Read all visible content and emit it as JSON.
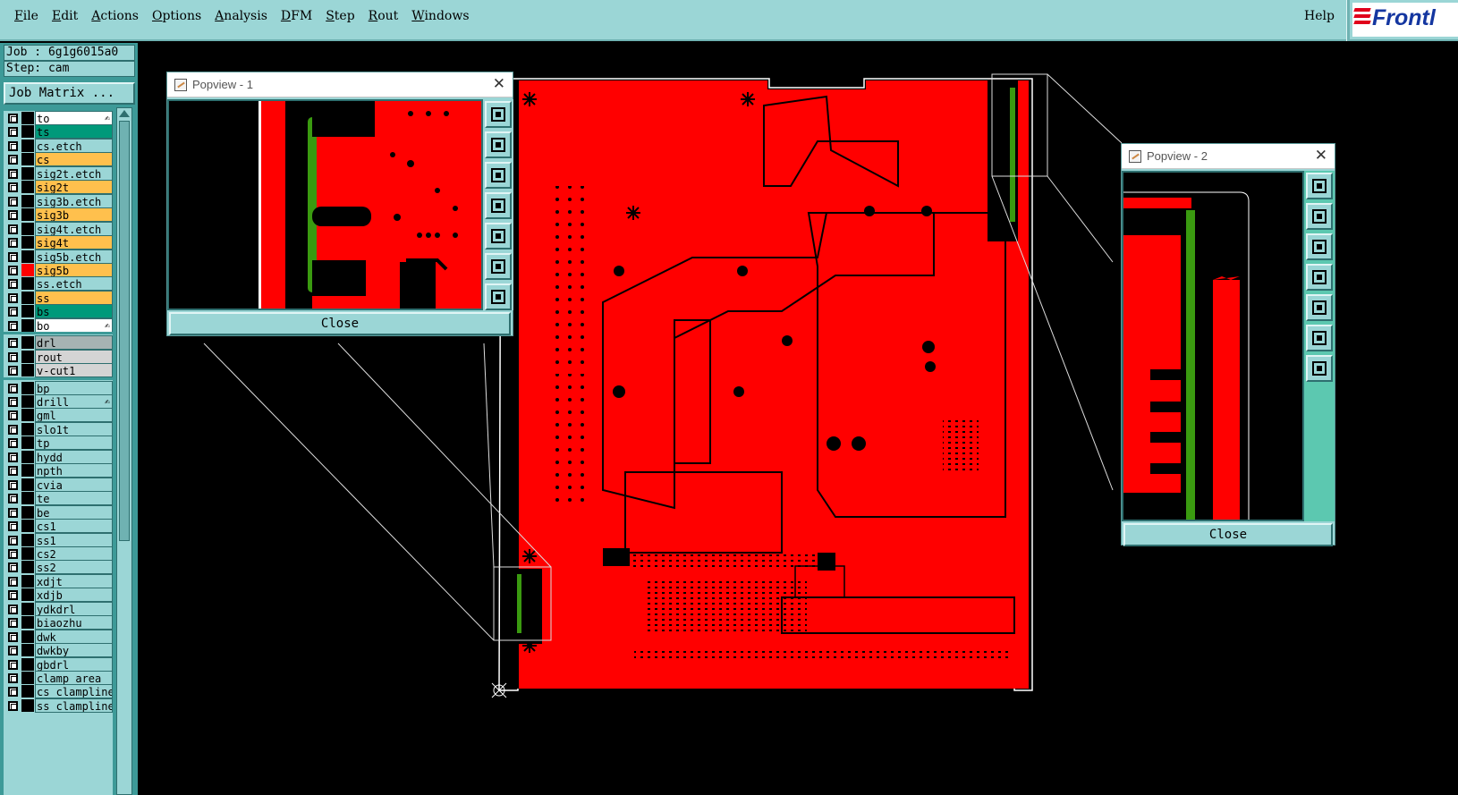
{
  "menubar": {
    "items": [
      {
        "label": "File",
        "ul": "F",
        "rest": "ile"
      },
      {
        "label": "Edit",
        "ul": "E",
        "rest": "dit"
      },
      {
        "label": "Actions",
        "ul": "A",
        "rest": "ctions"
      },
      {
        "label": "Options",
        "ul": "O",
        "rest": "ptions"
      },
      {
        "label": "Analysis",
        "ul": "A",
        "rest": "nalysis"
      },
      {
        "label": "DFM",
        "ul": "D",
        "rest": "FM"
      },
      {
        "label": "Step",
        "ul": "S",
        "rest": "tep"
      },
      {
        "label": "Rout",
        "ul": "R",
        "rest": "out"
      },
      {
        "label": "Windows",
        "ul": "W",
        "rest": "indows"
      }
    ],
    "help": "Help",
    "logo_text": "Frontl"
  },
  "job": {
    "job_line": "Job : 6g1g6015a0",
    "step_line": "Step: cam",
    "matrix_button": "Job Matrix ..."
  },
  "layers": [
    {
      "name": "to",
      "color": "#ffffff",
      "swatch": "#000000",
      "flag": "✍"
    },
    {
      "name": "ts",
      "color": "#00997a",
      "swatch": "#000000"
    },
    {
      "name": "cs.etch",
      "color": "#9bd6d6",
      "swatch": "#000000"
    },
    {
      "name": "cs",
      "color": "#ffc04d",
      "swatch": "#000000"
    },
    {
      "name": "sig2t.etch",
      "color": "#9bd6d6",
      "swatch": "#000000"
    },
    {
      "name": "sig2t",
      "color": "#ffc04d",
      "swatch": "#000000"
    },
    {
      "name": "sig3b.etch",
      "color": "#9bd6d6",
      "swatch": "#000000"
    },
    {
      "name": "sig3b",
      "color": "#ffc04d",
      "swatch": "#000000"
    },
    {
      "name": "sig4t.etch",
      "color": "#9bd6d6",
      "swatch": "#000000"
    },
    {
      "name": "sig4t",
      "color": "#ffc04d",
      "swatch": "#000000"
    },
    {
      "name": "sig5b.etch",
      "color": "#9bd6d6",
      "swatch": "#000000"
    },
    {
      "name": "sig5b",
      "color": "#ffc04d",
      "swatch": "#ff0000"
    },
    {
      "name": "ss.etch",
      "color": "#9bd6d6",
      "swatch": "#000000"
    },
    {
      "name": "ss",
      "color": "#ffc04d",
      "swatch": "#000000"
    },
    {
      "name": "bs",
      "color": "#00997a",
      "swatch": "#000000"
    },
    {
      "name": "bo",
      "color": "#ffffff",
      "swatch": "#000000",
      "flag": "✍"
    },
    {
      "name": "drl",
      "color": "#a6b3b3",
      "swatch": "#000000",
      "gap": true
    },
    {
      "name": "rout",
      "color": "#d4d4d4",
      "swatch": "#000000"
    },
    {
      "name": "v-cut1",
      "color": "#d4d4d4",
      "swatch": "#000000"
    },
    {
      "name": "bp",
      "color": "#9bd6d6",
      "swatch": "#000000",
      "gap": true
    },
    {
      "name": "drill",
      "color": "#9bd6d6",
      "swatch": "#000000",
      "flag": "✍"
    },
    {
      "name": "gml",
      "color": "#9bd6d6",
      "swatch": "#000000"
    },
    {
      "name": "slo1t",
      "color": "#9bd6d6",
      "swatch": "#000000"
    },
    {
      "name": "tp",
      "color": "#9bd6d6",
      "swatch": "#000000"
    },
    {
      "name": "hydd",
      "color": "#9bd6d6",
      "swatch": "#000000"
    },
    {
      "name": "npth",
      "color": "#9bd6d6",
      "swatch": "#000000"
    },
    {
      "name": "cvia",
      "color": "#9bd6d6",
      "swatch": "#000000"
    },
    {
      "name": "te",
      "color": "#9bd6d6",
      "swatch": "#000000"
    },
    {
      "name": "be",
      "color": "#9bd6d6",
      "swatch": "#000000"
    },
    {
      "name": "cs1",
      "color": "#9bd6d6",
      "swatch": "#000000"
    },
    {
      "name": "ss1",
      "color": "#9bd6d6",
      "swatch": "#000000"
    },
    {
      "name": "cs2",
      "color": "#9bd6d6",
      "swatch": "#000000"
    },
    {
      "name": "ss2",
      "color": "#9bd6d6",
      "swatch": "#000000"
    },
    {
      "name": "xdjt",
      "color": "#9bd6d6",
      "swatch": "#000000"
    },
    {
      "name": "xdjb",
      "color": "#9bd6d6",
      "swatch": "#000000"
    },
    {
      "name": "ydkdrl",
      "color": "#9bd6d6",
      "swatch": "#000000"
    },
    {
      "name": "biaozhu",
      "color": "#9bd6d6",
      "swatch": "#000000"
    },
    {
      "name": "dwk",
      "color": "#9bd6d6",
      "swatch": "#000000"
    },
    {
      "name": "dwkby",
      "color": "#9bd6d6",
      "swatch": "#000000"
    },
    {
      "name": "gbdrl",
      "color": "#9bd6d6",
      "swatch": "#000000"
    },
    {
      "name": "clamp_area",
      "color": "#9bd6d6",
      "swatch": "#000000"
    },
    {
      "name": "cs_clampline",
      "color": "#9bd6d6",
      "swatch": "#000000"
    },
    {
      "name": "ss_clampline",
      "color": "#9bd6d6",
      "swatch": "#000000"
    }
  ],
  "popview1": {
    "title": "Popview - 1",
    "close_label": "Close"
  },
  "popview2": {
    "title": "Popview - 2",
    "close_label": "Close"
  },
  "colors": {
    "copper": "#ff0000",
    "outline": "#ffffff",
    "trace_green": "#3a9a10",
    "ui_teal": "#9bd6d6"
  }
}
